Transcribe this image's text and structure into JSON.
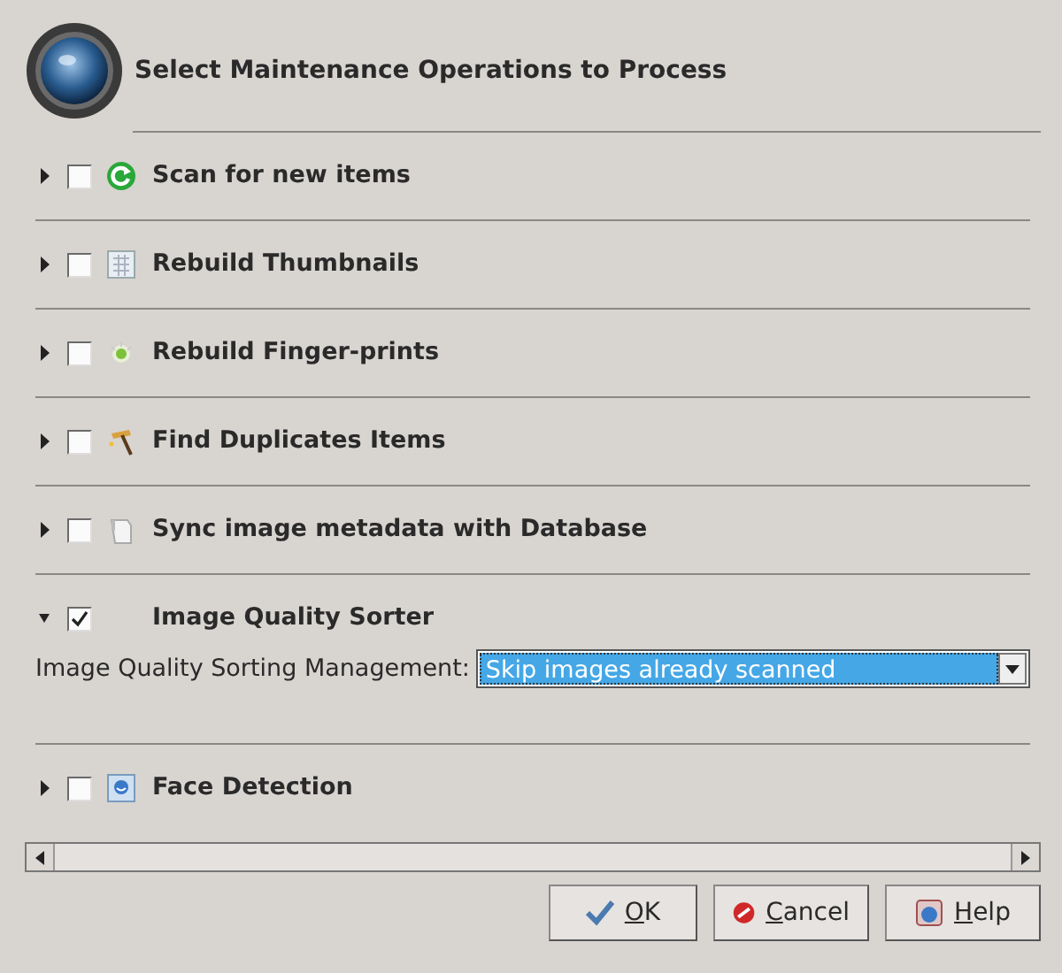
{
  "header": {
    "title": "Select Maintenance Operations to Process"
  },
  "operations": [
    {
      "kind": "scan",
      "label": "Scan for new items",
      "expanded": false,
      "checked": false
    },
    {
      "kind": "thumbnails",
      "label": "Rebuild Thumbnails",
      "expanded": false,
      "checked": false
    },
    {
      "kind": "fingerprints",
      "label": "Rebuild Finger-prints",
      "expanded": false,
      "checked": false
    },
    {
      "kind": "duplicates",
      "label": "Find Duplicates Items",
      "expanded": false,
      "checked": false
    },
    {
      "kind": "metadata",
      "label": "Sync image metadata with Database",
      "expanded": false,
      "checked": false
    },
    {
      "kind": "quality",
      "label": "Image Quality Sorter",
      "expanded": true,
      "checked": true,
      "setting": {
        "label": "Image Quality Sorting Management:",
        "value": "Skip images already scanned"
      }
    },
    {
      "kind": "faces",
      "label": "Face Detection",
      "expanded": false,
      "checked": false
    }
  ],
  "buttons": [
    {
      "kind": "ok",
      "mnemonic": "O",
      "rest": "K"
    },
    {
      "kind": "cancel",
      "mnemonic": "C",
      "rest": "ancel"
    },
    {
      "kind": "help",
      "mnemonic": "H",
      "rest": "elp"
    }
  ]
}
